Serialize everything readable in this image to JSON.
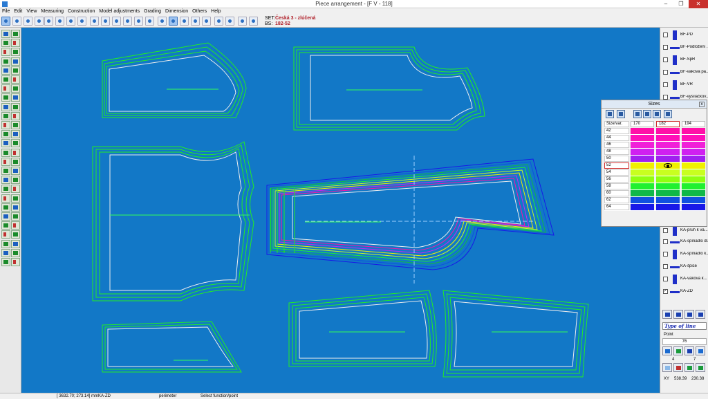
{
  "window": {
    "title": "Piece arrangement - [F V - 118]",
    "minimize": "–",
    "maximize": "❐",
    "close": "✕"
  },
  "menu": [
    "File",
    "Edit",
    "View",
    "Measuring",
    "Construction",
    "Model adjustments",
    "Grading",
    "Dimension",
    "Others",
    "Help"
  ],
  "set_info": {
    "set_label": "SET:",
    "set_value": "Česká 3 - zlúčená",
    "bs_label": "BS:",
    "bs_value": "182-52"
  },
  "pieces_panel": {
    "items": [
      {
        "label": "BF-PD",
        "checked": false
      },
      {
        "label": "BF-Podložení ...",
        "checked": false
      },
      {
        "label": "BF-SpR",
        "checked": false
      },
      {
        "label": "BF-vaková pa...",
        "checked": false
      },
      {
        "label": "BF-VR",
        "checked": false
      },
      {
        "label": "BF-vysílačkov...",
        "checked": false
      },
      {
        "label": "KA-pruh k va...",
        "checked": false
      },
      {
        "label": "KA-spínadlo dl...",
        "checked": false
      },
      {
        "label": "KA-spínadlo k...",
        "checked": false
      },
      {
        "label": "KA-špice",
        "checked": false
      },
      {
        "label": "KA-vaková k...",
        "checked": false
      },
      {
        "label": "KA-ZD",
        "checked": true
      }
    ]
  },
  "sizes_dialog": {
    "title": "Sizes",
    "close": "x",
    "header": {
      "label": "Size/var.",
      "cols": [
        "170",
        "182",
        "194"
      ]
    },
    "rows": [
      {
        "size": "42",
        "color": "#ff10a8"
      },
      {
        "size": "44",
        "color": "#ff10b8"
      },
      {
        "size": "46",
        "color": "#f020d8"
      },
      {
        "size": "48",
        "color": "#d020f0"
      },
      {
        "size": "50",
        "color": "#a020f0"
      },
      {
        "size": "52",
        "color": "#f0f000",
        "selected": true
      },
      {
        "size": "54",
        "color": "#c8ff20"
      },
      {
        "size": "56",
        "color": "#90ff10"
      },
      {
        "size": "58",
        "color": "#20f030"
      },
      {
        "size": "60",
        "color": "#10b848"
      },
      {
        "size": "62",
        "color": "#1050e0"
      },
      {
        "size": "64",
        "color": "#1818e8"
      }
    ]
  },
  "lower_panel": {
    "type_of_line": "Type of line",
    "point_label": "Point",
    "point_value": "76",
    "num_left": "4",
    "num_right": "7",
    "xy_label": "XY",
    "x_value": "538.39",
    "y_value": "230.38"
  },
  "status": {
    "coords": "[ 3632.70; 273.14] mm",
    "piece": "KA-ZD",
    "mode": "perimeter",
    "hint": "Select function/point"
  },
  "colors": {
    "canvas": "#1278c7",
    "piece_green": "#22ee22",
    "piece_selected": "#2020ff",
    "accent_red": "#b0202a"
  }
}
